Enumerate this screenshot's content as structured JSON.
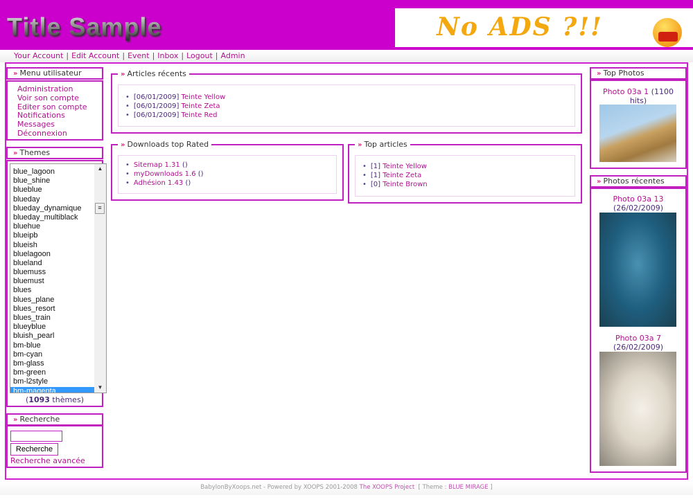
{
  "header": {
    "logo": "Title Sample",
    "banner": "No ADS ?!!",
    "accent": "#cc00cc"
  },
  "nav": [
    "Your Account",
    "Edit Account",
    "Event",
    "Inbox",
    "Logout",
    "Admin"
  ],
  "user_menu": {
    "title": "Menu utilisateur",
    "items": [
      "Administration",
      "Voir son compte",
      "Editer son compte",
      "Notifications",
      "Messages",
      "Déconnexion"
    ]
  },
  "themes": {
    "title": "Themes",
    "options": [
      "blue_lagoon",
      "blue_shine",
      "blueblue",
      "blueday",
      "blueday_dynamique",
      "blueday_multiblack",
      "bluehue",
      "blueipb",
      "blueish",
      "bluelagoon",
      "blueland",
      "bluemuss",
      "bluemust",
      "blues",
      "blues_plane",
      "blues_resort",
      "blues_train",
      "blueyblue",
      "bluish_pearl",
      "bm-blue",
      "bm-cyan",
      "bm-glass",
      "bm-green",
      "bm-l2style",
      "bm-magenta"
    ],
    "selected": "bm-magenta",
    "count": "1093",
    "count_suffix": " thèmes"
  },
  "search": {
    "title": "Recherche",
    "input_value": "",
    "button": "Recherche",
    "advanced": "Recherche avancée"
  },
  "recent_articles": {
    "title": "Articles récents",
    "items": [
      {
        "date": "[06/01/2009]",
        "title": "Teinte Yellow"
      },
      {
        "date": "[06/01/2009]",
        "title": "Teinte Zeta"
      },
      {
        "date": "[06/01/2009]",
        "title": "Teinte Red"
      }
    ]
  },
  "downloads": {
    "title": "Downloads top Rated",
    "items": [
      {
        "title": "Sitemap 1.31",
        "suffix": " ()"
      },
      {
        "title": "myDownloads 1.6",
        "suffix": " ()"
      },
      {
        "title": "Adhésion 1.43",
        "suffix": " ()"
      }
    ]
  },
  "top_articles": {
    "title": "Top articles",
    "items": [
      {
        "count": "[1]",
        "title": "Teinte Yellow"
      },
      {
        "count": "[1]",
        "title": "Teinte Zeta"
      },
      {
        "count": "[0]",
        "title": "Teinte Brown"
      }
    ]
  },
  "top_photos": {
    "title": "Top Photos",
    "photo": {
      "title": "Photo 03a 1",
      "meta": " (1100 hits)"
    }
  },
  "recent_photos": {
    "title": "Photos récentes",
    "photos": [
      {
        "title": "Photo 03a 13",
        "meta": " (26/02/2009)"
      },
      {
        "title": "Photo 03a 7",
        "meta": " (26/02/2009)"
      }
    ]
  },
  "footer": {
    "site": "BabylonByXoops.net - Powered by XOOPS 2001-2008 ",
    "project": "The XOOPS Project",
    "theme_prefix": "  [ Theme : ",
    "theme": "BLUE MIRAGE",
    "theme_suffix": " ]"
  }
}
